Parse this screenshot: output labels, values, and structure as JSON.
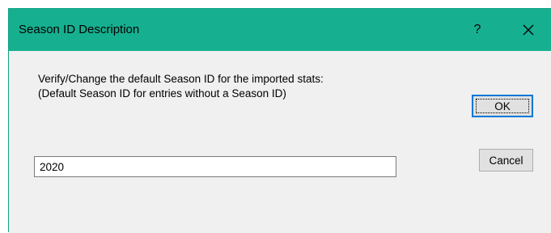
{
  "dialog": {
    "title": "Season ID Description",
    "help_label": "?",
    "close_icon": "close-icon",
    "prompt_line1": "Verify/Change the default Season ID for the imported stats:",
    "prompt_line2": "(Default Season ID for entries without a Season ID)",
    "season_id_value": "2020",
    "ok_label": "OK",
    "cancel_label": "Cancel"
  },
  "colors": {
    "titlebar": "#16b090",
    "client_background": "#f0f0f0",
    "default_button_border": "#0078d7"
  }
}
